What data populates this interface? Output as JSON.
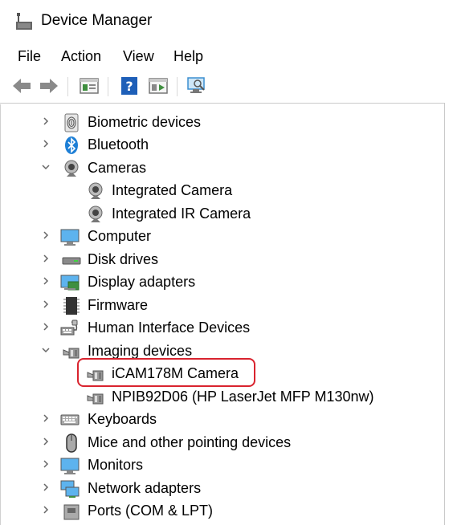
{
  "window": {
    "title": "Device Manager",
    "icon": "device-manager-icon"
  },
  "menu": [
    "File",
    "Action",
    "View",
    "Help"
  ],
  "toolbar": {
    "buttons": [
      "back-arrow-icon",
      "forward-arrow-icon",
      "properties-icon",
      "help-icon",
      "update-driver-icon",
      "scan-hardware-icon"
    ]
  },
  "tree": [
    {
      "label": "Biometric devices",
      "expanded": false,
      "level": 0,
      "icon": "fingerprint-icon"
    },
    {
      "label": "Bluetooth",
      "expanded": false,
      "level": 0,
      "icon": "bluetooth-icon"
    },
    {
      "label": "Cameras",
      "expanded": true,
      "level": 0,
      "icon": "webcam-icon"
    },
    {
      "label": "Integrated Camera",
      "level": 1,
      "icon": "webcam-icon"
    },
    {
      "label": "Integrated IR Camera",
      "level": 1,
      "icon": "webcam-icon"
    },
    {
      "label": "Computer",
      "expanded": false,
      "level": 0,
      "icon": "monitor-icon"
    },
    {
      "label": "Disk drives",
      "expanded": false,
      "level": 0,
      "icon": "disk-drive-icon"
    },
    {
      "label": "Display adapters",
      "expanded": false,
      "level": 0,
      "icon": "display-adapter-icon"
    },
    {
      "label": "Firmware",
      "expanded": false,
      "level": 0,
      "icon": "chip-icon"
    },
    {
      "label": "Human Interface Devices",
      "expanded": false,
      "level": 0,
      "icon": "hid-icon"
    },
    {
      "label": "Imaging devices",
      "expanded": true,
      "level": 0,
      "icon": "scanner-camera-icon"
    },
    {
      "label": "iCAM178M Camera",
      "level": 1,
      "icon": "scanner-camera-icon",
      "highlighted": true
    },
    {
      "label": "NPIB92D06 (HP LaserJet MFP M130nw)",
      "level": 1,
      "icon": "scanner-camera-icon"
    },
    {
      "label": "Keyboards",
      "expanded": false,
      "level": 0,
      "icon": "keyboard-icon"
    },
    {
      "label": "Mice and other pointing devices",
      "expanded": false,
      "level": 0,
      "icon": "mouse-icon"
    },
    {
      "label": "Monitors",
      "expanded": false,
      "level": 0,
      "icon": "monitor-icon"
    },
    {
      "label": "Network adapters",
      "expanded": false,
      "level": 0,
      "icon": "network-icon"
    },
    {
      "label": "Ports (COM & LPT)",
      "expanded": false,
      "level": 0,
      "icon": "port-icon"
    }
  ],
  "colors": {
    "highlight_border": "#d9232e",
    "accent_blue": "#1e7fd6"
  }
}
